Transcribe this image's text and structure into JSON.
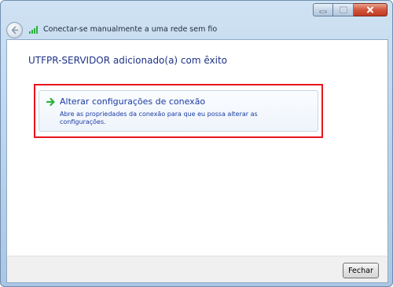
{
  "window": {
    "title": "Conectar-se manualmente a uma rede sem fio"
  },
  "main": {
    "heading": "UTFPR-SERVIDOR adicionado(a) com êxito",
    "command_link": {
      "title": "Alterar configurações de conexão",
      "description": "Abre as propriedades da conexão para que eu possa alterar as configurações."
    }
  },
  "footer": {
    "close_label": "Fechar"
  },
  "icons": {
    "back": "back-arrow-icon",
    "network": "wireless-signal-icon",
    "command_arrow": "green-arrow-icon",
    "minimize": "minimize-icon",
    "maximize": "maximize-icon",
    "close": "close-icon"
  },
  "colors": {
    "link_text": "#1a3aa3",
    "heading_text": "#1e3287",
    "highlight_border": "#e8151b",
    "arrow_green": "#2fb03f"
  }
}
